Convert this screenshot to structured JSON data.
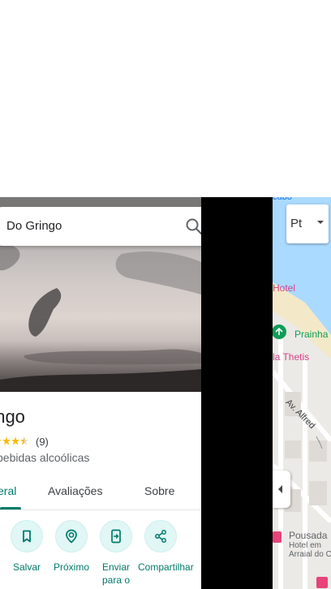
{
  "search": {
    "query": "Do Gringo"
  },
  "place": {
    "title": "ringo",
    "rating": 4.5,
    "reviews": "(9)",
    "category": "bebidas alcoólicas"
  },
  "tabs": [
    {
      "label": "eral",
      "active": true
    },
    {
      "label": "Avaliações",
      "active": false
    },
    {
      "label": "Sobre",
      "active": false
    }
  ],
  "actions": [
    {
      "label": "Salvar",
      "icon": "bookmark-icon"
    },
    {
      "label": "Próximo",
      "icon": "nearby-icon"
    },
    {
      "label": "Enviar para o",
      "icon": "send-to-phone-icon"
    },
    {
      "label": "Compartilhar",
      "icon": "share-icon"
    }
  ],
  "map": {
    "top_label": "cubo",
    "hotel": "Hotel",
    "prainha": "Prainha",
    "thetis": "la Thetis",
    "avenue": "Av. Alfred",
    "pousada": "Pousada",
    "pousada_sub1": "Hotel em",
    "pousada_sub2": "Arraial do C"
  },
  "language_button": {
    "label": "Pt"
  },
  "colors": {
    "accent": "#00796b",
    "action_bg": "#e0f7f6",
    "star": "#fbbc04",
    "map_water": "#aadaff",
    "map_label_pink": "#d6418b"
  }
}
